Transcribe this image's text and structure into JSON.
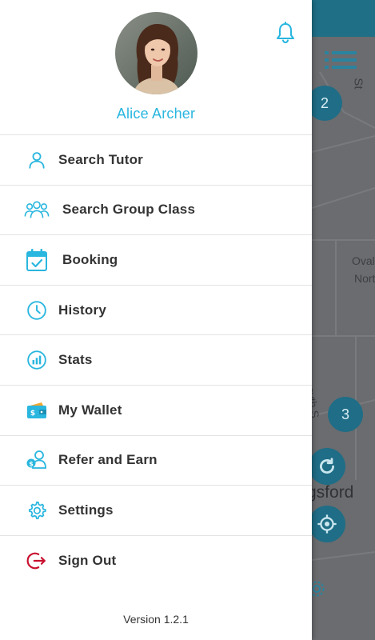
{
  "user": {
    "name": "Alice Archer"
  },
  "menu": [
    {
      "label": "Search Tutor",
      "icon": "user-icon"
    },
    {
      "label": "Search Group Class",
      "icon": "group-icon"
    },
    {
      "label": "Booking",
      "icon": "calendar-check-icon"
    },
    {
      "label": "History",
      "icon": "clock-icon"
    },
    {
      "label": "Stats",
      "icon": "stats-icon"
    },
    {
      "label": "My Wallet",
      "icon": "wallet-icon"
    },
    {
      "label": "Refer and Earn",
      "icon": "refer-icon"
    },
    {
      "label": "Settings",
      "icon": "gear-icon"
    },
    {
      "label": "Sign Out",
      "icon": "sign-out-icon"
    }
  ],
  "footer": {
    "version": "Version 1.2.1"
  },
  "map": {
    "marker_2": "2",
    "marker_3": "3",
    "street_st": "St",
    "street_oval": "Oval",
    "street_nort": "Nort",
    "street_forsyth": "Forsyth S",
    "place_gsford": "gsford"
  },
  "colors": {
    "accent": "#29b6df",
    "sign_out": "#c8102e",
    "text": "#333333"
  }
}
